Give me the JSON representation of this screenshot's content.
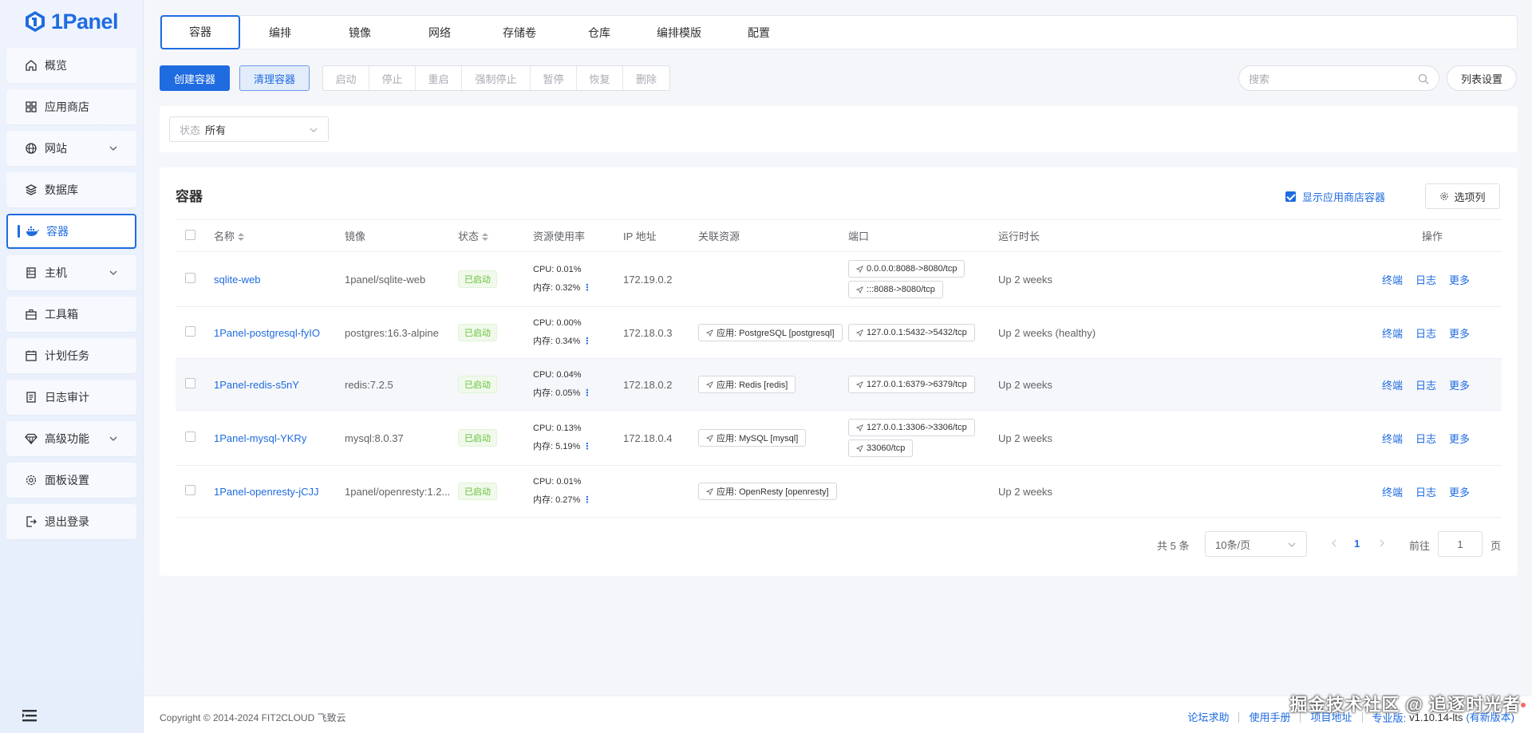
{
  "brand": {
    "name": "1Panel",
    "color": "#1f6be0"
  },
  "sidebar": {
    "items": [
      {
        "label": "概览",
        "icon": "home-icon"
      },
      {
        "label": "应用商店",
        "icon": "grid-icon"
      },
      {
        "label": "网站",
        "icon": "globe-icon",
        "expandable": true
      },
      {
        "label": "数据库",
        "icon": "layers-icon"
      },
      {
        "label": "容器",
        "icon": "docker-icon",
        "active": true
      },
      {
        "label": "主机",
        "icon": "server-icon",
        "expandable": true
      },
      {
        "label": "工具箱",
        "icon": "toolbox-icon"
      },
      {
        "label": "计划任务",
        "icon": "calendar-icon"
      },
      {
        "label": "日志审计",
        "icon": "log-icon"
      },
      {
        "label": "高级功能",
        "icon": "diamond-icon",
        "expandable": true
      },
      {
        "label": "面板设置",
        "icon": "gear-icon"
      },
      {
        "label": "退出登录",
        "icon": "logout-icon"
      }
    ]
  },
  "tabs": [
    "容器",
    "编排",
    "镜像",
    "网络",
    "存储卷",
    "仓库",
    "编排模版",
    "配置"
  ],
  "toolbar": {
    "create": "创建容器",
    "clean": "清理容器",
    "group": [
      "启动",
      "停止",
      "重启",
      "强制停止",
      "暂停",
      "恢复",
      "删除"
    ],
    "search_placeholder": "搜索",
    "list_settings": "列表设置"
  },
  "filter": {
    "label": "状态",
    "value": "所有"
  },
  "card": {
    "title": "容器",
    "show_app_label": "显示应用商店容器",
    "column_select": "选项列"
  },
  "table": {
    "headers": {
      "name": "名称",
      "image": "镜像",
      "status": "状态",
      "resources": "资源使用率",
      "ip": "IP 地址",
      "related": "关联资源",
      "ports": "端口",
      "uptime": "运行时长",
      "ops": "操作"
    },
    "rows": [
      {
        "name": "sqlite-web",
        "image": "1panel/sqlite-web",
        "status": "已启动",
        "cpu": "CPU: 0.01%",
        "mem": "内存: 0.32%",
        "ip": "172.19.0.2",
        "related": "",
        "ports": [
          "0.0.0.0:8088->8080/tcp",
          ":::8088->8080/tcp"
        ],
        "uptime": "Up 2 weeks"
      },
      {
        "name": "1Panel-postgresql-fyIO",
        "image": "postgres:16.3-alpine",
        "status": "已启动",
        "cpu": "CPU: 0.00%",
        "mem": "内存: 0.34%",
        "ip": "172.18.0.3",
        "related": "应用: PostgreSQL [postgresql]",
        "ports": [
          "127.0.0.1:5432->5432/tcp"
        ],
        "uptime": "Up 2 weeks (healthy)"
      },
      {
        "name": "1Panel-redis-s5nY",
        "image": "redis:7.2.5",
        "status": "已启动",
        "cpu": "CPU: 0.04%",
        "mem": "内存: 0.05%",
        "ip": "172.18.0.2",
        "related": "应用: Redis [redis]",
        "ports": [
          "127.0.0.1:6379->6379/tcp"
        ],
        "uptime": "Up 2 weeks",
        "highlight": true
      },
      {
        "name": "1Panel-mysql-YKRy",
        "image": "mysql:8.0.37",
        "status": "已启动",
        "cpu": "CPU: 0.13%",
        "mem": "内存: 5.19%",
        "ip": "172.18.0.4",
        "related": "应用: MySQL [mysql]",
        "ports": [
          "127.0.0.1:3306->3306/tcp",
          "33060/tcp"
        ],
        "uptime": "Up 2 weeks"
      },
      {
        "name": "1Panel-openresty-jCJJ",
        "image": "1panel/openresty:1.2...",
        "status": "已启动",
        "cpu": "CPU: 0.01%",
        "mem": "内存: 0.27%",
        "ip": "",
        "related": "应用: OpenResty [openresty]",
        "ports": [],
        "uptime": "Up 2 weeks"
      }
    ],
    "ops_labels": {
      "terminal": "终端",
      "log": "日志",
      "more": "更多"
    }
  },
  "pager": {
    "total": "共 5 条",
    "size": "10条/页",
    "current": "1",
    "goto": "前往",
    "goto_value": "1",
    "page": "页"
  },
  "footer": {
    "copyright": "Copyright © 2014-2024 FIT2CLOUD 飞致云",
    "links": [
      "论坛求助",
      "使用手册",
      "项目地址"
    ],
    "edition": "专业版:",
    "version": "v1.10.14-lts",
    "new_version": "(有新版本)"
  },
  "watermark": "掘金技术社区 @ 追逐时光者"
}
